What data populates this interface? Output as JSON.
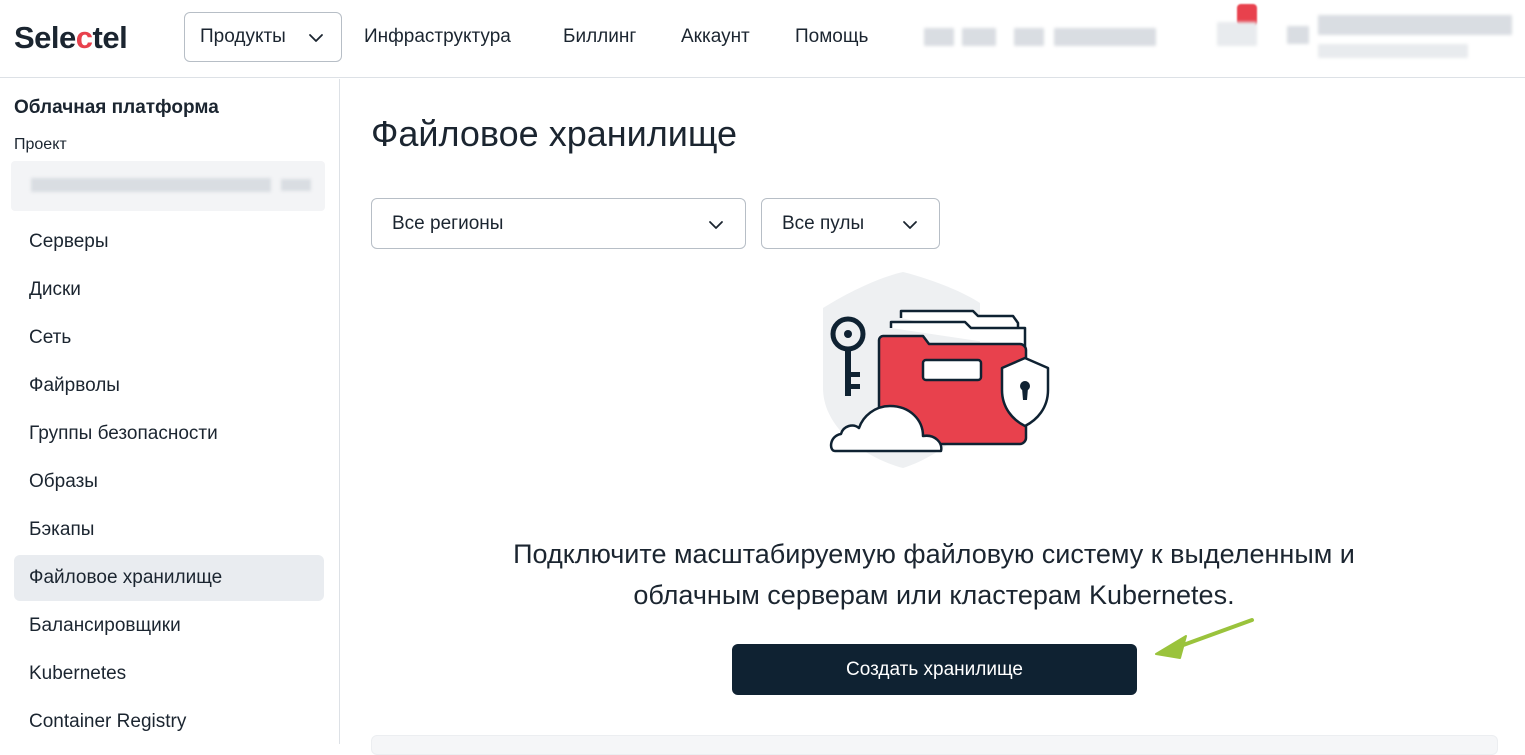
{
  "header": {
    "logo_left": "Sele",
    "logo_c": "c",
    "logo_right": "tel",
    "products_label": "Продукты",
    "nav": [
      "Инфраструктура",
      "Биллинг",
      "Аккаунт",
      "Помощь"
    ]
  },
  "sidebar": {
    "title": "Облачная платформа",
    "project_label": "Проект",
    "items": [
      {
        "label": "Серверы"
      },
      {
        "label": "Диски"
      },
      {
        "label": "Сеть"
      },
      {
        "label": "Файрволы"
      },
      {
        "label": "Группы безопасности"
      },
      {
        "label": "Образы"
      },
      {
        "label": "Бэкапы"
      },
      {
        "label": "Файловое хранилище",
        "active": true
      },
      {
        "label": "Балансировщики"
      },
      {
        "label": "Kubernetes"
      },
      {
        "label": "Container Registry"
      }
    ]
  },
  "main": {
    "title": "Файловое хранилище",
    "region_filter": "Все регионы",
    "pool_filter": "Все пулы",
    "empty_line1": "Подключите масштабируемую файловую систему к выделенным и",
    "empty_line2": "облачным серверам или кластерам Kubernetes.",
    "create_button": "Создать хранилище"
  },
  "colors": {
    "brand_red": "#e8414d",
    "dark_navy": "#0f2232",
    "annotation_arrow": "#9ac33c",
    "active_item_bg": "#e9ecf0"
  },
  "icons": [
    "chevron-down-icon",
    "key-icon",
    "folder-icon",
    "shield-lock-icon",
    "cloud-icon",
    "arrow-annotation"
  ]
}
